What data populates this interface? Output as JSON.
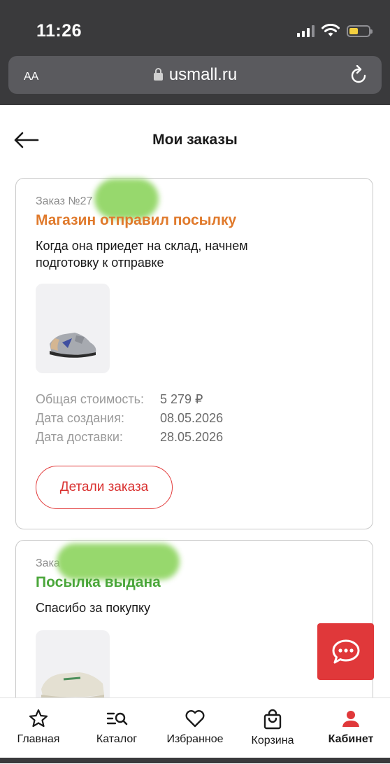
{
  "status_bar": {
    "time": "11:26",
    "battery_level": 0.45,
    "battery_color": "#f4d03f"
  },
  "browser": {
    "text_size_label": "AA",
    "url": "usmall.ru"
  },
  "header": {
    "title": "Мои заказы"
  },
  "orders": [
    {
      "number": "Заказ №27",
      "status": "Магазин отправил посылку",
      "status_color": "#e07a2c",
      "description": "Когда она приедет на склад, начнем подготовку к отправке",
      "rows": [
        {
          "label": "Общая стоимость:",
          "value": "5 279 ₽"
        },
        {
          "label": "Дата создания:",
          "value": "08.05.2026"
        },
        {
          "label": "Дата доставки:",
          "value": "28.05.2026"
        }
      ],
      "details_label": "Детали  заказа"
    },
    {
      "number": "Зака",
      "status": "Посылка выдана",
      "status_color": "#4aa63a",
      "description": "Спасибо за покупку"
    }
  ],
  "nav": {
    "items": [
      {
        "label": "Главная",
        "icon": "star-icon"
      },
      {
        "label": "Каталог",
        "icon": "catalog-search-icon"
      },
      {
        "label": "Избранное",
        "icon": "heart-icon"
      },
      {
        "label": "Корзина",
        "icon": "bag-icon"
      },
      {
        "label": "Кабинет",
        "icon": "user-icon",
        "active": true
      }
    ]
  },
  "colors": {
    "accent": "#e0383a",
    "chrome": "#3a3a3c"
  }
}
